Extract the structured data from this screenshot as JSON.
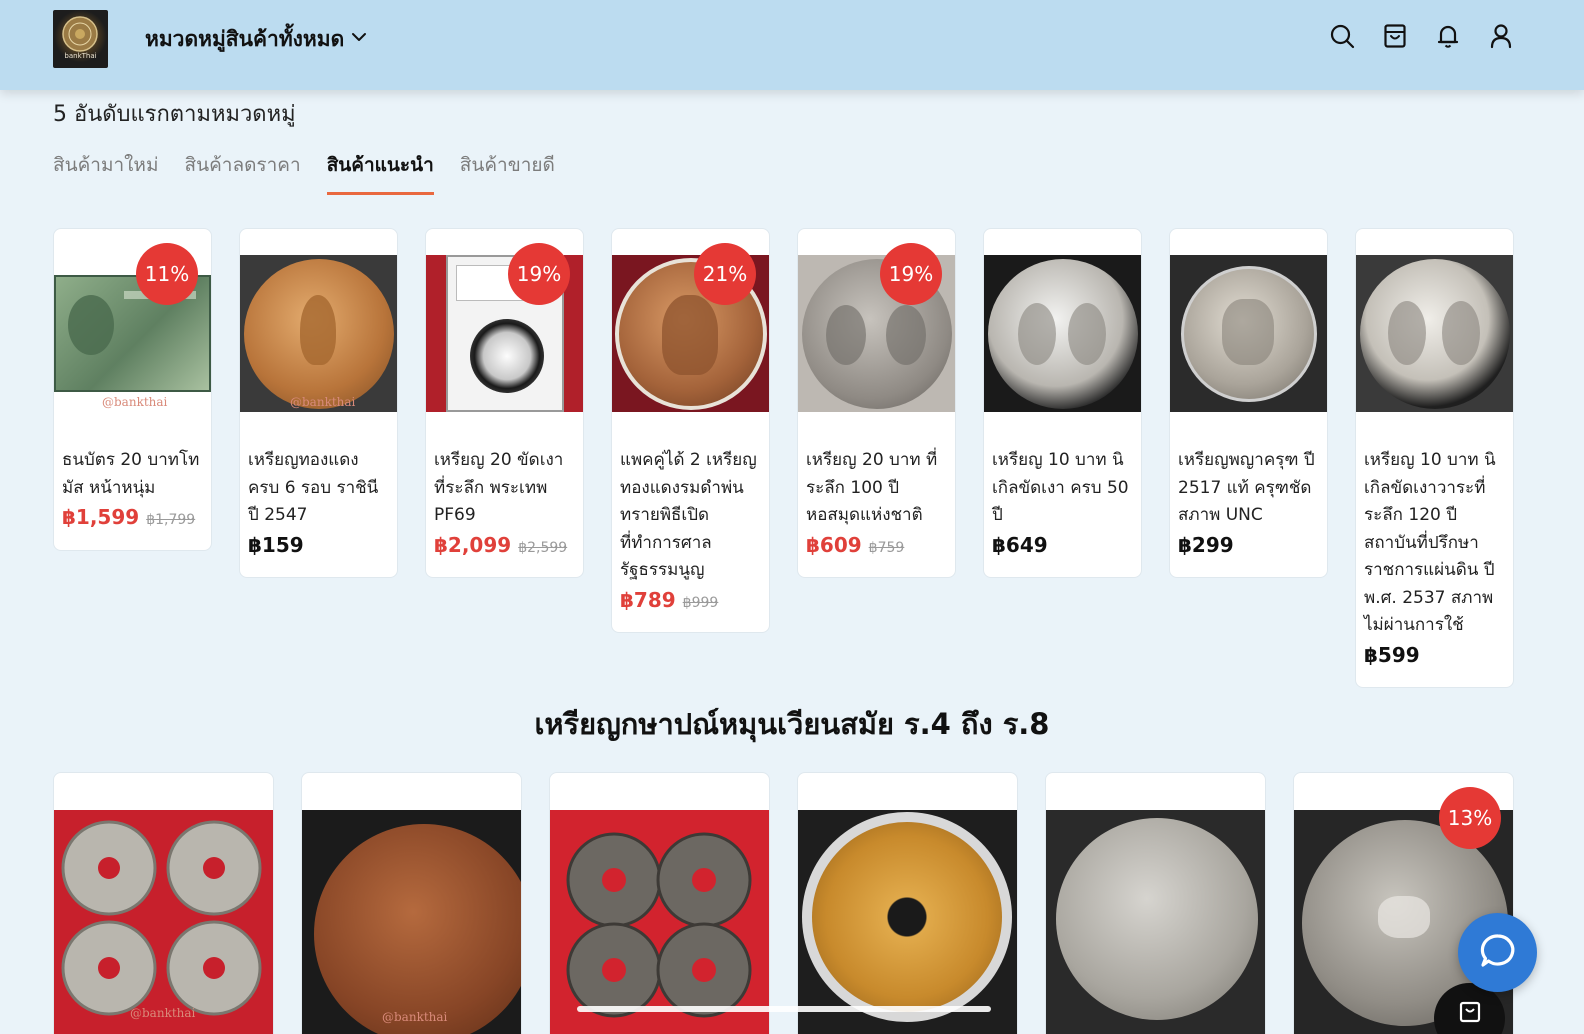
{
  "header": {
    "logo_text": "bankThai",
    "category_menu": "หมวดหมู่สินค้าทั้งหมด"
  },
  "section_title": "5 อันดับแรกตามหมวดหมู่",
  "tabs": [
    {
      "label": "สินค้ามาใหม่",
      "active": false
    },
    {
      "label": "สินค้าลดราคา",
      "active": false
    },
    {
      "label": "สินค้าแนะนำ",
      "active": true
    },
    {
      "label": "สินค้าขายดี",
      "active": false
    }
  ],
  "products": [
    {
      "name": "ธนบัตร 20 บาทโทมัส หน้าหนุ่ม",
      "price": "฿1,599",
      "old_price": "฿1,799",
      "discount": "11%",
      "watermark": "@bankthai"
    },
    {
      "name": "เหรียญทองแดง ครบ 6 รอบ ราชินี ปี 2547",
      "price": "฿159",
      "old_price": "",
      "discount": "",
      "watermark": "@bankthai"
    },
    {
      "name": "เหรียญ 20 ขัดเงา ที่ระลึก พระเทพ PF69",
      "price": "฿2,099",
      "old_price": "฿2,599",
      "discount": "19%",
      "watermark": ""
    },
    {
      "name": "แพคคู่ได้ 2 เหรียญ ทองแดงรมดำพ่น ทรายพิธีเปิด ที่ทำการศาล รัฐธรรมนูญ",
      "price": "฿789",
      "old_price": "฿999",
      "discount": "21%",
      "watermark": ""
    },
    {
      "name": "เหรียญ 20 บาท ที่ ระลึก 100 ปี หอสมุดแห่งชาติ",
      "price": "฿609",
      "old_price": "฿759",
      "discount": "19%",
      "watermark": ""
    },
    {
      "name": "เหรียญ 10 บาท นิ เกิลขัดเงา ครบ 50 ปี",
      "price": "฿649",
      "old_price": "",
      "discount": "",
      "watermark": ""
    },
    {
      "name": "เหรียญพญาครุฑ ปี 2517 แท้ ครุฑชัด สภาพ UNC",
      "price": "฿299",
      "old_price": "",
      "discount": "",
      "watermark": ""
    },
    {
      "name": "เหรียญ 10 บาท นิ เกิลขัดเงาวาระที่ ระลึก 120 ปี สถาบันที่ปรึกษา ราชการแผ่นดิน ปี พ.ศ. 2537 สภาพ ไม่ผ่านการใช้",
      "price": "฿599",
      "old_price": "",
      "discount": "",
      "watermark": ""
    }
  ],
  "section2_title": "เหรียญกษาปณ์หมุนเวียนสมัย ร.4 ถึง ร.8",
  "section2_cards": [
    {
      "discount": "",
      "watermark": "@bankthai"
    },
    {
      "discount": "",
      "watermark": "@bankthai"
    },
    {
      "discount": "",
      "watermark": ""
    },
    {
      "discount": "",
      "watermark": ""
    },
    {
      "discount": "",
      "watermark": ""
    },
    {
      "discount": "13%",
      "watermark": ""
    }
  ],
  "colors": {
    "header_bg": "#bcdcf0",
    "page_bg": "#eaf3f9",
    "accent_tab": "#e9683f",
    "sale_price": "#e0403a",
    "badge": "#e53935",
    "chat_button": "#2f7ad6"
  },
  "icons": {
    "search": "search-icon",
    "orders": "orders-icon",
    "notifications": "bell-icon",
    "account": "user-icon",
    "category_dropdown": "chevron-down-icon",
    "chat": "chat-icon",
    "cart": "cart-icon"
  }
}
